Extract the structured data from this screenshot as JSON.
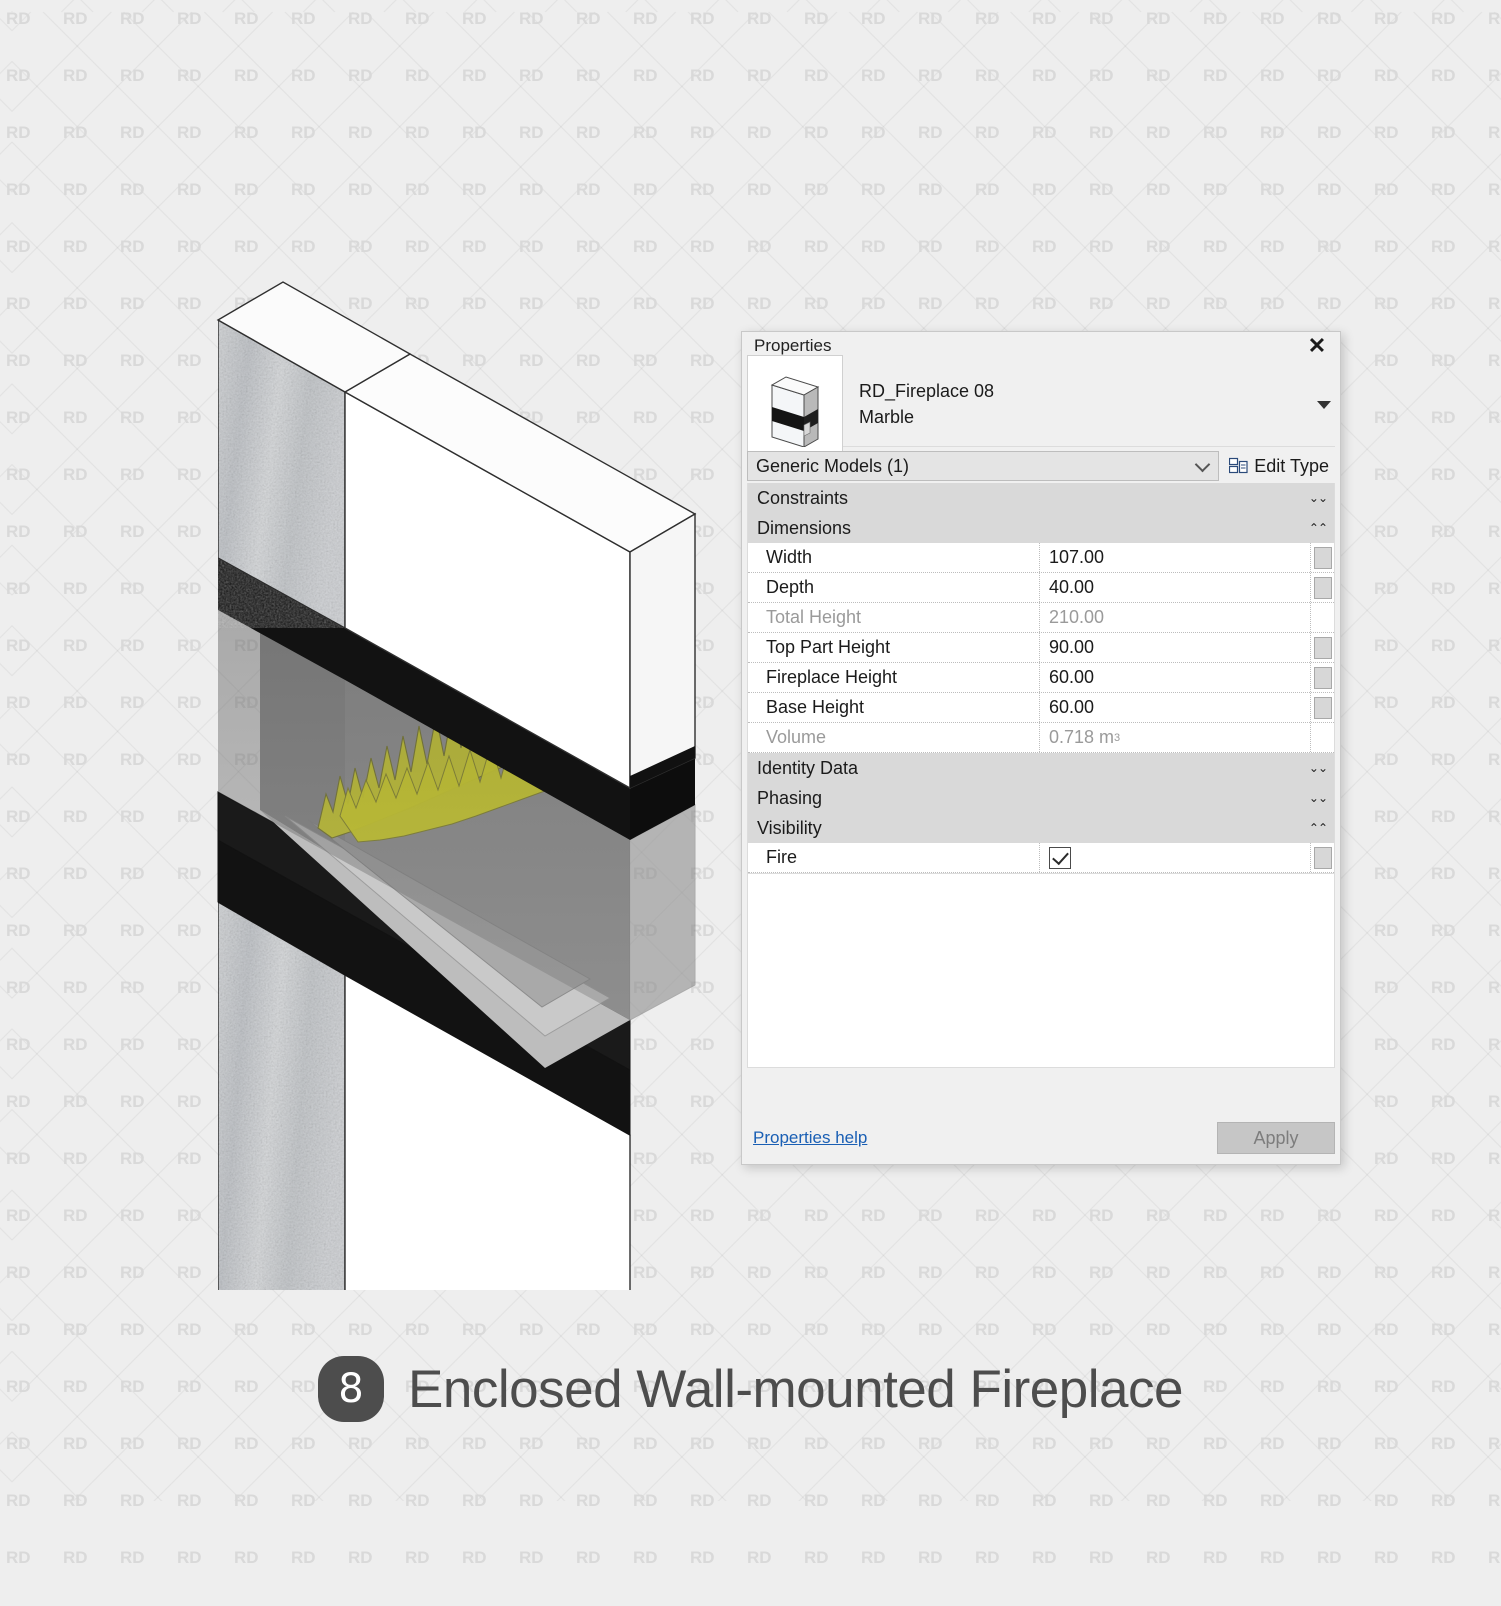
{
  "watermark": {
    "text": "RD"
  },
  "panel": {
    "title": "Properties",
    "close_icon": "✕",
    "type_name": "RD_Fireplace 08",
    "type_variant": "Marble",
    "category_selector": "Generic Models (1)",
    "edit_type_label": "Edit Type",
    "groups": [
      {
        "name": "Constraints",
        "state": "collapsed",
        "chevron": "⌄⌄",
        "rows": []
      },
      {
        "name": "Dimensions",
        "state": "expanded",
        "chevron": "⌃⌃",
        "rows": [
          {
            "label": "Width",
            "value": "107.00",
            "readonly": false,
            "override": true
          },
          {
            "label": "Depth",
            "value": "40.00",
            "readonly": false,
            "override": true
          },
          {
            "label": "Total Height",
            "value": "210.00",
            "readonly": true,
            "override": false
          },
          {
            "label": "Top Part Height",
            "value": "90.00",
            "readonly": false,
            "override": true
          },
          {
            "label": "Fireplace Height",
            "value": "60.00",
            "readonly": false,
            "override": true
          },
          {
            "label": "Base Height",
            "value": "60.00",
            "readonly": false,
            "override": true
          },
          {
            "label": "Volume",
            "value": "0.718 m",
            "superscript": "3",
            "readonly": true,
            "override": false
          }
        ]
      },
      {
        "name": "Identity Data",
        "state": "collapsed",
        "chevron": "⌄⌄",
        "rows": []
      },
      {
        "name": "Phasing",
        "state": "collapsed",
        "chevron": "⌄⌄",
        "rows": []
      },
      {
        "name": "Visibility",
        "state": "expanded",
        "chevron": "⌃⌃",
        "rows": [
          {
            "label": "Fire",
            "value": "",
            "checkbox": true,
            "checked": true,
            "readonly": false,
            "override": true
          }
        ]
      }
    ],
    "help_link": "Properties help",
    "apply_label": "Apply"
  },
  "caption": {
    "number": "8",
    "title": "Enclosed Wall-mounted Fireplace"
  },
  "colors": {
    "background": "#eeeeee",
    "panel_bg": "#f0f0f0",
    "group_header": "#d9d9d9",
    "link": "#1a5fb4",
    "flame": "#e8e817",
    "caption_text": "#4d4d4d"
  },
  "model": {
    "name": "fireplace-isometric-view",
    "parts": [
      "top-block",
      "firebox-opening",
      "flame",
      "base-block",
      "marble-side-panel"
    ]
  }
}
